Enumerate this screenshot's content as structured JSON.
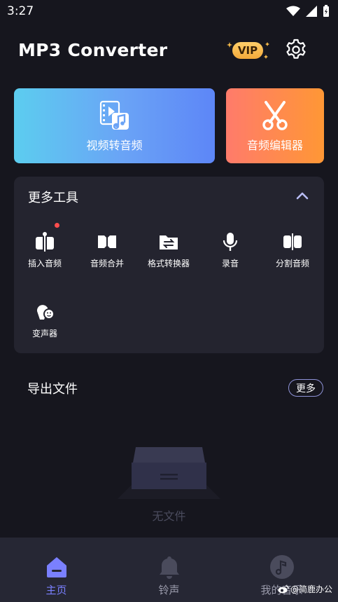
{
  "status_bar": {
    "time": "3:27"
  },
  "header": {
    "title": "MP3 Converter",
    "vip_label": "VIP"
  },
  "cards": {
    "video_to_audio": {
      "label": "视频转音频"
    },
    "audio_editor": {
      "label": "音频编辑器"
    }
  },
  "tools": {
    "title": "更多工具",
    "items": [
      {
        "label": "插入音频",
        "icon": "insert-audio-icon",
        "has_badge": true
      },
      {
        "label": "音频合并",
        "icon": "merge-audio-icon"
      },
      {
        "label": "格式转换器",
        "icon": "format-convert-icon"
      },
      {
        "label": "录音",
        "icon": "microphone-icon"
      },
      {
        "label": "分割音频",
        "icon": "split-audio-icon"
      },
      {
        "label": "变声器",
        "icon": "voice-changer-icon"
      }
    ]
  },
  "export": {
    "title": "导出文件",
    "more_label": "更多",
    "empty_text": "无文件"
  },
  "bottom_nav": {
    "items": [
      {
        "label": "主页",
        "active": true,
        "icon": "home-icon"
      },
      {
        "label": "铃声",
        "active": false,
        "icon": "bell-icon"
      },
      {
        "label": "我的音乐",
        "active": false,
        "icon": "music-disc-icon"
      }
    ]
  },
  "watermark": {
    "text": "@简鹿办公"
  },
  "colors": {
    "background": "#16161e",
    "panel": "#24242f",
    "accent": "#7a80ff",
    "vip_gold": "#f3a93a"
  }
}
